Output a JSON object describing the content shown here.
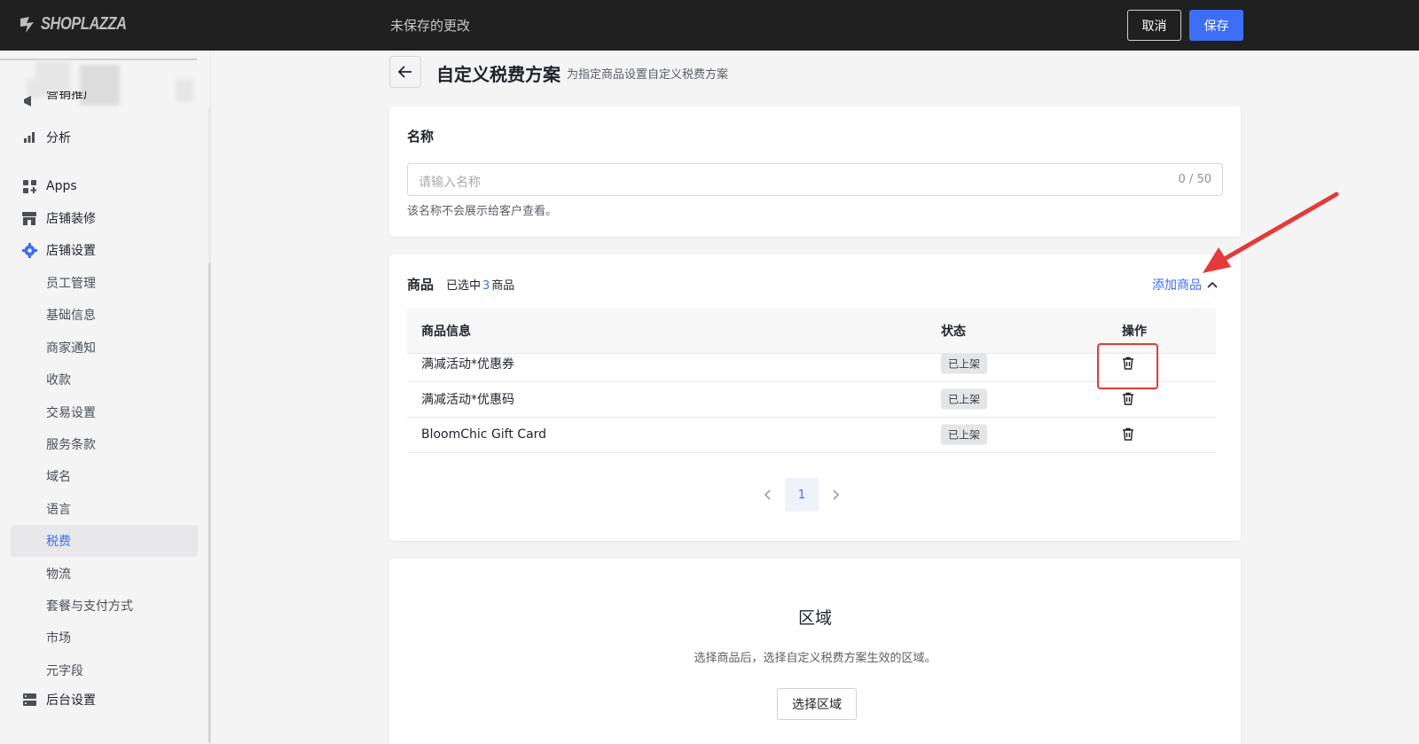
{
  "header": {
    "logo_text": "SHOPLAZZA",
    "unsaved_text": "未保存的更改",
    "cancel_label": "取消",
    "save_label": "保存"
  },
  "sidebar": {
    "partial_item": "营销推广",
    "items": [
      {
        "label": "分析",
        "icon": "bar-chart-icon"
      },
      {
        "label": "Apps",
        "icon": "apps-grid-icon"
      },
      {
        "label": "店铺装修",
        "icon": "storefront-icon"
      },
      {
        "label": "店铺设置",
        "icon": "gear-icon",
        "active": true
      }
    ],
    "sub_items": [
      "员工管理",
      "基础信息",
      "商家通知",
      "收款",
      "交易设置",
      "服务条款",
      "域名",
      "语言",
      "税费",
      "物流",
      "套餐与支付方式",
      "市场",
      "元字段"
    ],
    "active_sub": "税费",
    "bottom_item": {
      "label": "后台设置",
      "icon": "server-icon"
    }
  },
  "page": {
    "title": "自定义税费方案",
    "subtitle": "为指定商品设置自定义税费方案"
  },
  "name_card": {
    "label": "名称",
    "placeholder": "请输入名称",
    "counter": "0 / 50",
    "hint": "该名称不会展示给客户查看。"
  },
  "products_card": {
    "label": "商品",
    "selected_prefix": "已选中",
    "selected_count": "3",
    "selected_suffix": "商品",
    "add_link": "添加商品",
    "columns": [
      "商品信息",
      "状态",
      "操作"
    ],
    "rows": [
      {
        "name": "满减活动*优惠券",
        "status": "已上架"
      },
      {
        "name": "满减活动*优惠码",
        "status": "已上架"
      },
      {
        "name": "BloomChic Gift Card",
        "status": "已上架"
      }
    ],
    "page": "1"
  },
  "region_card": {
    "title": "区域",
    "desc": "选择商品后，选择自定义税费方案生效的区域。",
    "button": "选择区域"
  },
  "colors": {
    "accent": "#3d6ef6",
    "annotation": "#e5393b",
    "topbar": "#202020"
  }
}
